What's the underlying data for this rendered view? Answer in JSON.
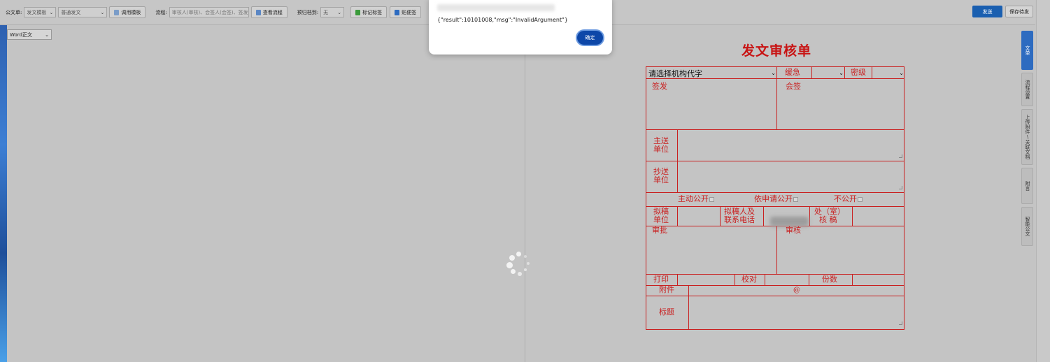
{
  "toolbar": {
    "doc_type_label": "公文单:",
    "doc_template_value": "发文模板",
    "doc_kind_value": "普通发文",
    "apply_template_button": "调用模板",
    "flow_label": "流程:",
    "flow_value": "审核人(审核)、会签人(会签)、签发人",
    "view_flow_button": "查看流程",
    "archive_label": "预归档到:",
    "archive_value": "无",
    "mark_tag_button": "标记标签",
    "sticky_button": "贴便签",
    "send_button": "发送",
    "save_button": "保存待发"
  },
  "left_pane": {
    "view_select_value": "Word正文"
  },
  "dialog": {
    "message": "{\"result\":10101008,\"msg\":\"InvalidArgument\"}",
    "ok_button": "确定"
  },
  "side_tabs": [
    {
      "label": "文单",
      "active": true
    },
    {
      "label": "流程设置",
      "active": false
    },
    {
      "label": "上传附件\\关联文档",
      "active": false
    },
    {
      "label": "附言",
      "active": false
    },
    {
      "label": "智能公文",
      "active": false
    }
  ],
  "form": {
    "title": "发文审核单",
    "org_select_value": "请选择机构代字",
    "urgency_label": "缓急",
    "secret_label": "密级",
    "sign_label": "签发",
    "countersign_label": "会签",
    "main_send_label_1": "主送",
    "main_send_label_2": "单位",
    "copy_send_label_1": "抄送",
    "copy_send_label_2": "单位",
    "public_active": "主动公开",
    "public_apply": "依申请公开",
    "not_public": "不公开",
    "draft_unit_1": "拟稿",
    "draft_unit_2": "单位",
    "drafter_1": "拟稿人及",
    "drafter_2": "联系电话",
    "office_1": "处（室）",
    "office_2": "核 稿",
    "approve_label": "审批",
    "review_label": "审核",
    "print_label": "打印",
    "proof_label": "校对",
    "copies_label": "份数",
    "attachment_label": "附件",
    "attachment_value": "@",
    "subject_label": "标题"
  },
  "colors": {
    "accent_blue": "#1a5fb0",
    "form_red": "#c92020"
  }
}
